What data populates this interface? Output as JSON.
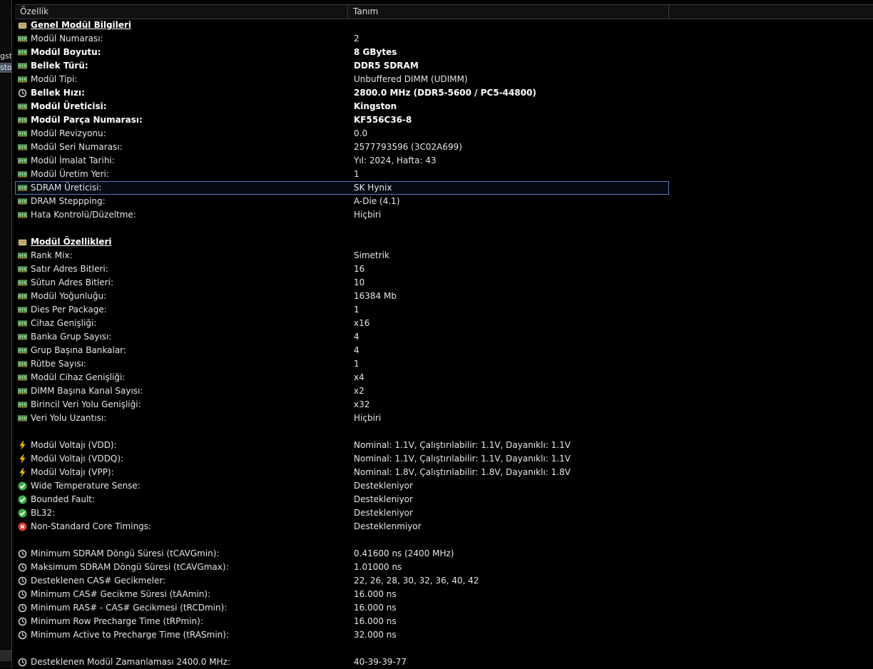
{
  "left_panel": {
    "stub_1": "gst",
    "stub_2": "sto"
  },
  "header": {
    "col_property": "Özellik",
    "col_value": "Tanım"
  },
  "sections": [
    {
      "type": "section",
      "icon": "module-folder-icon",
      "label": "Genel Modül Bilgileri"
    },
    {
      "icon": "memory-icon",
      "label": "Modül Numarası:",
      "value": "2"
    },
    {
      "icon": "memory-icon",
      "label": "Modül Boyutu:",
      "value": "8 GBytes",
      "bold": true
    },
    {
      "icon": "memory-icon",
      "label": "Bellek Türü:",
      "value": "DDR5 SDRAM",
      "bold": true
    },
    {
      "icon": "memory-icon",
      "label": "Modül Tipi:",
      "value": "Unbuffered DIMM (UDIMM)"
    },
    {
      "icon": "clock-icon",
      "label": "Bellek Hızı:",
      "value": "2800.0 MHz (DDR5-5600 / PC5-44800)",
      "bold": true
    },
    {
      "icon": "memory-icon",
      "label": "Modül Üreticisi:",
      "value": "Kingston",
      "bold": true
    },
    {
      "icon": "memory-icon",
      "label": "Modül Parça Numarası:",
      "value": "KF556C36-8",
      "bold": true
    },
    {
      "icon": "memory-icon",
      "label": "Modül Revizyonu:",
      "value": "0.0"
    },
    {
      "icon": "memory-icon",
      "label": "Modül Seri Numarası:",
      "value": "2577793596 (3C02A699)"
    },
    {
      "icon": "memory-icon",
      "label": "Modül İmalat Tarihi:",
      "value": "Yıl: 2024, Hafta: 43"
    },
    {
      "icon": "memory-icon",
      "label": "Modül Üretim Yeri:",
      "value": "1"
    },
    {
      "icon": "memory-icon",
      "label": "SDRAM Üreticisi:",
      "value": "SK Hynix",
      "selected": true
    },
    {
      "icon": "memory-icon",
      "label": "DRAM Steppping:",
      "value": "A-Die (4.1)"
    },
    {
      "icon": "memory-icon",
      "label": "Hata Kontrolü/Düzeltme:",
      "value": "Hiçbiri"
    },
    {
      "type": "gap"
    },
    {
      "type": "section",
      "icon": "module-folder-icon",
      "label": "Modül Özellikleri"
    },
    {
      "icon": "memory-icon",
      "label": "Rank Mix:",
      "value": "Simetrik"
    },
    {
      "icon": "memory-icon",
      "label": "Satır Adres Bitleri:",
      "value": "16"
    },
    {
      "icon": "memory-icon",
      "label": "Sütun Adres Bitleri:",
      "value": "10"
    },
    {
      "icon": "memory-icon",
      "label": "Modül Yoğunluğu:",
      "value": "16384 Mb"
    },
    {
      "icon": "memory-icon",
      "label": "Dies Per Package:",
      "value": "1"
    },
    {
      "icon": "memory-icon",
      "label": "Cihaz Genişliği:",
      "value": "x16"
    },
    {
      "icon": "memory-icon",
      "label": "Banka Grup Sayısı:",
      "value": "4"
    },
    {
      "icon": "memory-icon",
      "label": "Grup Başına Bankalar:",
      "value": "4"
    },
    {
      "icon": "memory-icon",
      "label": "Rütbe Sayısı:",
      "value": "1"
    },
    {
      "icon": "memory-icon",
      "label": "Modül Cihaz Genişliği:",
      "value": "x4"
    },
    {
      "icon": "memory-icon",
      "label": "DIMM Başına Kanal Sayısı:",
      "value": "x2"
    },
    {
      "icon": "memory-icon",
      "label": "Birincil Veri Yolu Genişliği:",
      "value": "x32"
    },
    {
      "icon": "memory-icon",
      "label": "Veri Yolu Uzantısı:",
      "value": "Hiçbiri"
    },
    {
      "type": "gap"
    },
    {
      "icon": "voltage-icon",
      "label": "Modül Voltajı (VDD):",
      "value": "Nominal: 1.1V, Çalıştırılabilir: 1.1V, Dayanıklı: 1.1V"
    },
    {
      "icon": "voltage-icon",
      "label": "Modül Voltajı (VDDQ):",
      "value": "Nominal: 1.1V, Çalıştırılabilir: 1.1V, Dayanıklı: 1.1V"
    },
    {
      "icon": "voltage-icon",
      "label": "Modül Voltajı (VPP):",
      "value": "Nominal: 1.8V, Çalıştırılabilir: 1.8V, Dayanıklı: 1.8V"
    },
    {
      "icon": "check-icon",
      "label": "Wide Temperature Sense:",
      "value": "Destekleniyor"
    },
    {
      "icon": "check-icon",
      "label": "Bounded Fault:",
      "value": "Destekleniyor"
    },
    {
      "icon": "check-icon",
      "label": "BL32:",
      "value": "Destekleniyor"
    },
    {
      "icon": "cross-icon",
      "label": "Non-Standard Core Timings:",
      "value": "Desteklenmiyor"
    },
    {
      "type": "gap"
    },
    {
      "icon": "clock-icon",
      "label": "Minimum SDRAM Döngü Süresi (tCAVGmin):",
      "value": "0.41600 ns (2400 MHz)"
    },
    {
      "icon": "clock-icon",
      "label": "Maksimum SDRAM Döngü Süresi (tCAVGmax):",
      "value": "1.01000 ns"
    },
    {
      "icon": "clock-icon",
      "label": "Desteklenen CAS# Gecikmeler:",
      "value": "22, 26, 28, 30, 32, 36, 40, 42"
    },
    {
      "icon": "clock-icon",
      "label": "Minimum CAS# Gecikme Süresi (tAAmin):",
      "value": "16.000 ns"
    },
    {
      "icon": "clock-icon",
      "label": "Minimum RAS# - CAS# Gecikmesi (tRCDmin):",
      "value": "16.000 ns"
    },
    {
      "icon": "clock-icon",
      "label": "Minimum Row Precharge Time (tRPmin):",
      "value": "16.000 ns"
    },
    {
      "icon": "clock-icon",
      "label": "Minimum Active to Precharge Time (tRASmin):",
      "value": "32.000 ns"
    },
    {
      "type": "gap"
    },
    {
      "icon": "clock-icon",
      "label": "Desteklenen Modül Zamanlaması 2400.0 MHz:",
      "value": "40-39-39-77"
    }
  ],
  "colors": {
    "background": "#000000",
    "text": "#e6e6e6",
    "selection_border": "#4f7db0",
    "memory_icon": "#5fa05f",
    "voltage_icon": "#f5c400",
    "check_icon": "#3cb043",
    "cross_icon": "#d9382f"
  }
}
